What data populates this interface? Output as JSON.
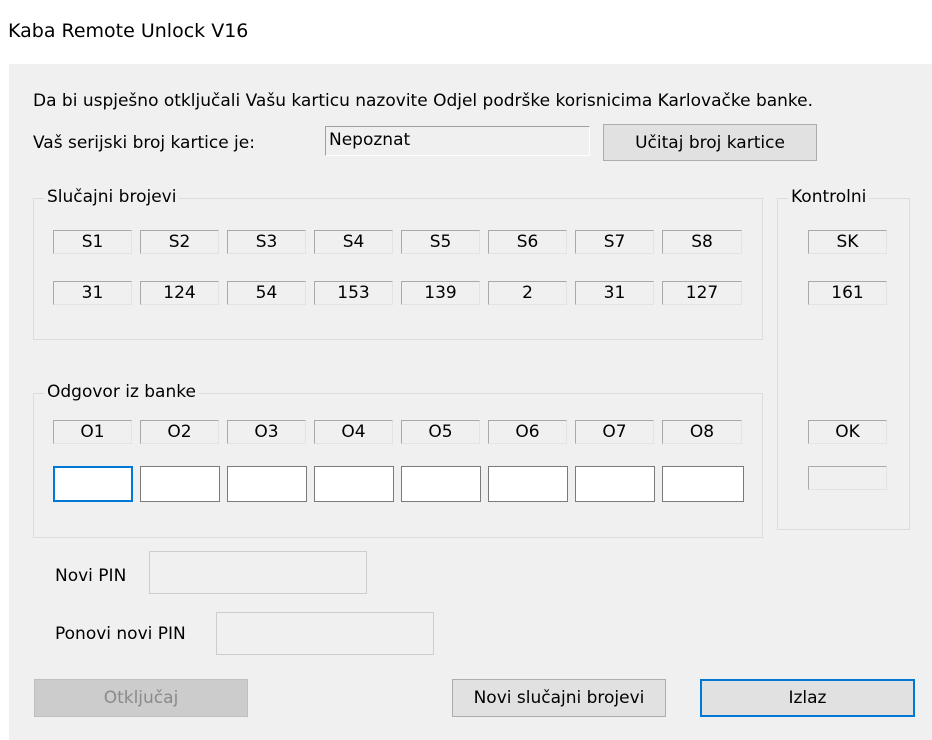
{
  "window": {
    "title": "Kaba Remote Unlock V16"
  },
  "instruction": "Da bi uspješno otključali Vašu karticu nazovite Odjel podrške korisnicima Karlovačke banke.",
  "serial": {
    "label": "Vaš serijski broj kartice je:",
    "value": "Nepoznat",
    "read_button": "Učitaj broj kartice"
  },
  "random_group": {
    "title": "Slučajni brojevi",
    "headers": [
      "S1",
      "S2",
      "S3",
      "S4",
      "S5",
      "S6",
      "S7",
      "S8"
    ],
    "values": [
      "31",
      "124",
      "54",
      "153",
      "139",
      "2",
      "31",
      "127"
    ]
  },
  "control_group": {
    "title": "Kontrolni",
    "header": "SK",
    "value": "161",
    "ok_label": "OK",
    "ok_value": ""
  },
  "answer_group": {
    "title": "Odgovor iz banke",
    "headers": [
      "O1",
      "O2",
      "O3",
      "O4",
      "O5",
      "O6",
      "O7",
      "O8"
    ],
    "values": [
      "",
      "",
      "",
      "",
      "",
      "",
      "",
      ""
    ]
  },
  "pin": {
    "new_label": "Novi PIN",
    "new_value": "",
    "repeat_label": "Ponovi novi PIN",
    "repeat_value": ""
  },
  "buttons": {
    "unlock": "Otključaj",
    "new_random": "Novi slučajni brojevi",
    "exit": "Izlaz"
  }
}
